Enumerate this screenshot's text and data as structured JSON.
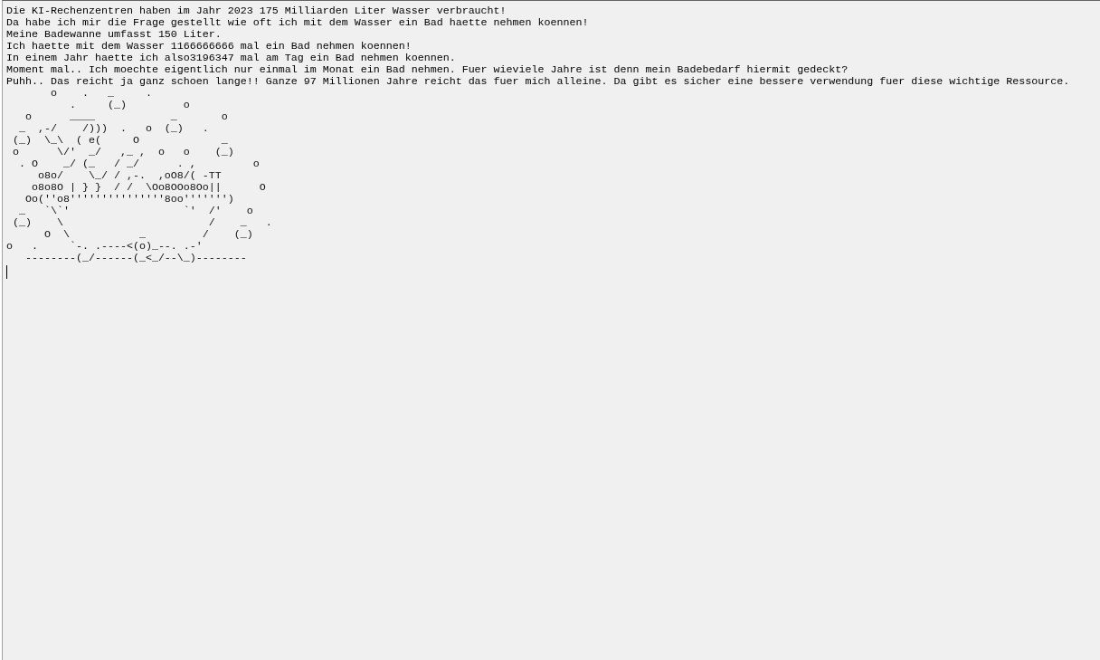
{
  "console": {
    "lines": [
      "Die KI-Rechenzentren haben im Jahr 2023 175 Milliarden Liter Wasser verbraucht!",
      "Da habe ich mir die Frage gestellt wie oft ich mit dem Wasser ein Bad haette nehmen koennen!",
      "Meine Badewanne umfasst 150 Liter.",
      "Ich haette mit dem Wasser 1166666666 mal ein Bad nehmen koennen!",
      "In einem Jahr haette ich also3196347 mal am Tag ein Bad nehmen koennen.",
      "Moment mal.. Ich moechte eigentlich nur einmal im Monat ein Bad nehmen. Fuer wieviele Jahre ist denn mein Badebedarf hiermit gedeckt?",
      "Puhh.. Das reicht ja ganz schoen lange!! Ganze 97 Millionen Jahre reicht das fuer mich alleine. Da gibt es sicher eine bessere verwendung fuer diese wichtige Ressource."
    ],
    "art": [
      "       o    .   _     .",
      "          .     (_)         o",
      "   o      ____            _       o",
      "  _  ,-/    /)))  .   o  (_)   .",
      " (_)  \\_\\  ( e(     O             _",
      " o      \\/'  _/   ,_ ,  o   o    (_)",
      "  . O    _/ (_   / _/      . ,         o",
      "     o8o/    \\_/ / ,-.  ,oO8/( -TT",
      "    o8o8O | } }  / /  \\Oo8OOo8Oo||      O",
      "   Oo(''o8'''''''''''''''8oo''''''')",
      "  _   `\\`'                  `'  /'    o",
      " (_)    \\                       /    _   .",
      "      O  \\           _         /    (_)",
      "o   .     `-. .----<(o)_--. .-'",
      "   --------(_/------(_<_/--\\_)--------"
    ],
    "caret": true
  }
}
